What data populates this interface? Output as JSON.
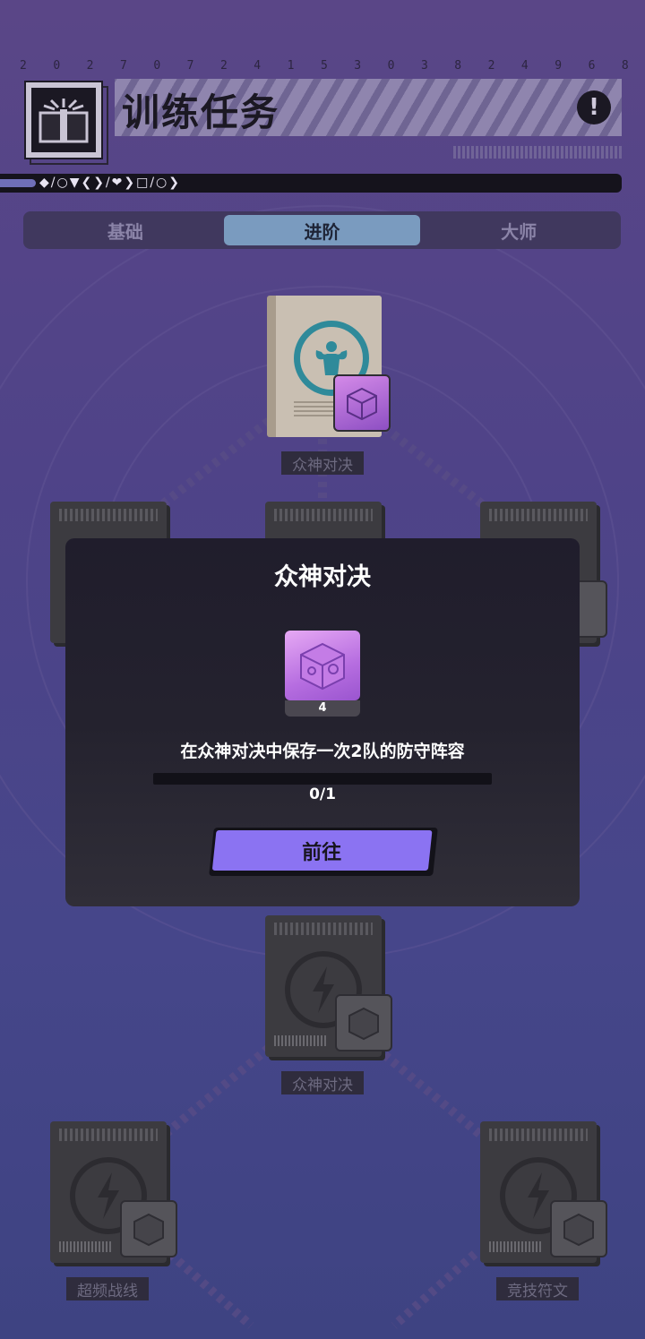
{
  "header": {
    "date_digits": [
      "2",
      "0",
      "2",
      "7",
      "0",
      "7",
      "2",
      "4",
      "1",
      "5",
      "3",
      "0",
      "3",
      "8",
      "2",
      "4",
      "9",
      "6",
      "8"
    ],
    "title": "训练任务",
    "alert_symbol": "!",
    "symbol_string": "◆/○▼❮❯/❤❯□/○❯"
  },
  "tabs": [
    {
      "label": "基础",
      "active": false
    },
    {
      "label": "进阶",
      "active": true
    },
    {
      "label": "大师",
      "active": false
    }
  ],
  "nodes": {
    "top_label": "众神对决",
    "middle_label": "众神对决",
    "bottom_left_label": "超频战线",
    "bottom_right_label": "竞技符文"
  },
  "modal": {
    "title": "众神对决",
    "reward_count": "4",
    "description": "在众神对决中保存一次2队的防守阵容",
    "progress_text": "0/1",
    "progress_current": 0,
    "progress_total": 1,
    "button_label": "前往"
  },
  "colors": {
    "accent": "#8b73f2",
    "tab_active": "#7a9bbf",
    "background_top": "#5a4687",
    "background_bottom": "#3e4382"
  },
  "icons": {
    "title_icon": "open-book-icon",
    "alert_icon": "exclamation-icon",
    "reward_icon": "rune-cube-icon",
    "node_emblem": "lightning-icon",
    "top_node_emblem": "strongman-icon"
  }
}
